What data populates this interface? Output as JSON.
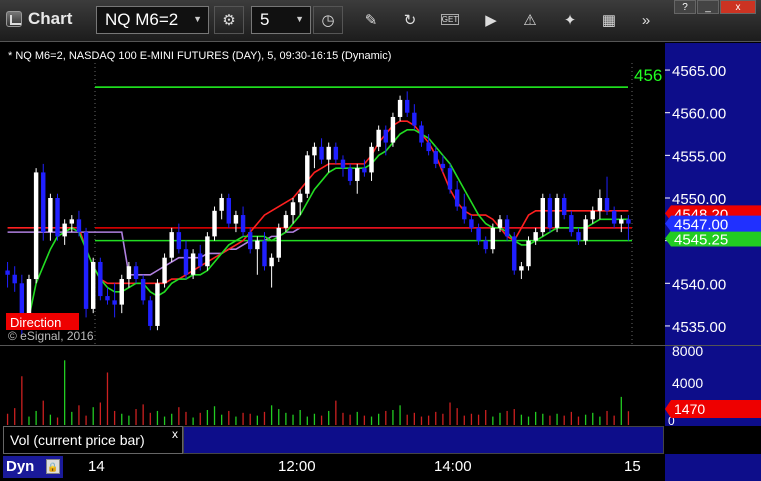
{
  "titlebar": {
    "app_title": "Chart",
    "symbol": "NQ M6=2",
    "interval": "5",
    "window_buttons": [
      "?",
      "_",
      "x"
    ]
  },
  "toolbar": {
    "tools": [
      "link-icon",
      "interval-icon",
      "clock-icon",
      "pencil-icon",
      "refresh-icon",
      "get-icon",
      "play-icon",
      "alert-icon",
      "settings-icon",
      "chevron-icon"
    ]
  },
  "chart": {
    "header": "* NQ M6=2, NASDAQ 100 E-MINI FUTURES (DAY), 5, 09:30-16:15 (Dynamic)",
    "alert_line_label": "456",
    "direction_label": "Direction",
    "watermark": "© eSignal, 2016",
    "price_ticks": [
      "4565.00",
      "4560.00",
      "4555.00",
      "4550.00",
      "4545.00",
      "4540.00",
      "4535.00"
    ],
    "price_flag_high": "4548.20",
    "price_flag_last": "4547.00",
    "price_flag_low": "4545.25",
    "colors": {
      "up_candle": "#ffffff",
      "down_candle": "#2020ff",
      "ma_fast": "#22dd22",
      "ma_slow": "#ff2020",
      "ma_long": "#b080e0",
      "axis_bg": "#0d0d8a"
    }
  },
  "volume": {
    "ticks": [
      "8000",
      "4000",
      "0"
    ],
    "last_volume": "1470",
    "tab_label": "Vol (current price bar)",
    "tab_close": "x"
  },
  "bottom": {
    "mode": "Dyn",
    "time_labels": [
      "14",
      "12:00",
      "14:00",
      "15"
    ]
  },
  "chart_data": {
    "type": "candlestick",
    "ylim": [
      4533,
      4567
    ],
    "candles": [
      [
        4541.5,
        4542.5,
        4539.5,
        4541.0
      ],
      [
        4541.0,
        4542.0,
        4539.0,
        4540.0
      ],
      [
        4540.0,
        4541.0,
        4534.0,
        4535.5
      ],
      [
        4535.5,
        4541.0,
        4535.0,
        4540.5
      ],
      [
        4540.5,
        4553.5,
        4540.0,
        4553.0
      ],
      [
        4553.0,
        4554.0,
        4545.0,
        4546.0
      ],
      [
        4546.0,
        4550.5,
        4545.0,
        4550.0
      ],
      [
        4550.0,
        4550.5,
        4545.0,
        4545.5
      ],
      [
        4545.5,
        4547.5,
        4544.5,
        4547.0
      ],
      [
        4547.0,
        4548.0,
        4546.0,
        4547.5
      ],
      [
        4547.5,
        4548.5,
        4545.5,
        4546.0
      ],
      [
        4546.0,
        4546.5,
        4536.0,
        4537.0
      ],
      [
        4537.0,
        4543.0,
        4536.5,
        4542.5
      ],
      [
        4542.5,
        4543.0,
        4538.0,
        4538.5
      ],
      [
        4538.5,
        4539.5,
        4537.5,
        4538.0
      ],
      [
        4538.0,
        4540.0,
        4536.0,
        4537.5
      ],
      [
        4537.5,
        4541.0,
        4536.5,
        4540.5
      ],
      [
        4540.5,
        4542.5,
        4539.5,
        4542.0
      ],
      [
        4542.0,
        4542.5,
        4540.0,
        4540.5
      ],
      [
        4540.5,
        4541.0,
        4537.5,
        4538.0
      ],
      [
        4538.0,
        4538.5,
        4534.5,
        4535.0
      ],
      [
        4535.0,
        4540.5,
        4534.5,
        4540.0
      ],
      [
        4540.0,
        4543.5,
        4539.5,
        4543.0
      ],
      [
        4543.0,
        4546.5,
        4542.5,
        4546.0
      ],
      [
        4546.0,
        4547.0,
        4543.5,
        4544.0
      ],
      [
        4544.0,
        4545.0,
        4540.5,
        4541.0
      ],
      [
        4541.0,
        4544.0,
        4540.5,
        4543.5
      ],
      [
        4543.5,
        4544.5,
        4541.5,
        4542.0
      ],
      [
        4542.0,
        4546.0,
        4541.5,
        4545.5
      ],
      [
        4545.5,
        4549.0,
        4545.0,
        4548.5
      ],
      [
        4548.5,
        4550.5,
        4547.5,
        4550.0
      ],
      [
        4550.0,
        4550.5,
        4546.5,
        4547.0
      ],
      [
        4547.0,
        4548.5,
        4546.0,
        4548.0
      ],
      [
        4548.0,
        4549.0,
        4545.5,
        4546.0
      ],
      [
        4546.0,
        4546.5,
        4543.5,
        4544.0
      ],
      [
        4544.0,
        4545.5,
        4541.0,
        4545.0
      ],
      [
        4545.0,
        4546.0,
        4541.5,
        4542.0
      ],
      [
        4542.0,
        4543.5,
        4539.5,
        4543.0
      ],
      [
        4543.0,
        4547.0,
        4542.5,
        4546.5
      ],
      [
        4546.5,
        4548.5,
        4546.0,
        4548.0
      ],
      [
        4548.0,
        4550.0,
        4547.0,
        4549.5
      ],
      [
        4549.5,
        4551.0,
        4548.0,
        4550.5
      ],
      [
        4550.5,
        4555.5,
        4550.0,
        4555.0
      ],
      [
        4555.0,
        4556.5,
        4553.5,
        4556.0
      ],
      [
        4556.0,
        4557.0,
        4554.0,
        4554.5
      ],
      [
        4554.5,
        4556.5,
        4553.0,
        4556.0
      ],
      [
        4556.0,
        4556.5,
        4554.0,
        4554.5
      ],
      [
        4554.5,
        4555.0,
        4552.5,
        4553.5
      ],
      [
        4553.5,
        4554.0,
        4551.5,
        4552.0
      ],
      [
        4552.0,
        4554.0,
        4550.5,
        4553.5
      ],
      [
        4553.5,
        4554.5,
        4552.5,
        4553.0
      ],
      [
        4553.0,
        4556.5,
        4552.0,
        4556.0
      ],
      [
        4556.0,
        4558.5,
        4555.5,
        4558.0
      ],
      [
        4558.0,
        4558.5,
        4555.0,
        4556.5
      ],
      [
        4556.5,
        4560.0,
        4556.0,
        4559.5
      ],
      [
        4559.5,
        4562.0,
        4559.0,
        4561.5
      ],
      [
        4561.5,
        4562.5,
        4559.5,
        4560.0
      ],
      [
        4560.0,
        4561.0,
        4558.0,
        4558.5
      ],
      [
        4558.5,
        4559.0,
        4556.0,
        4556.5
      ],
      [
        4556.5,
        4557.5,
        4555.0,
        4555.5
      ],
      [
        4555.5,
        4556.0,
        4553.5,
        4554.0
      ],
      [
        4554.0,
        4555.0,
        4553.0,
        4553.5
      ],
      [
        4553.5,
        4554.0,
        4550.5,
        4551.0
      ],
      [
        4551.0,
        4552.0,
        4548.5,
        4549.0
      ],
      [
        4549.0,
        4550.5,
        4547.0,
        4547.5
      ],
      [
        4547.5,
        4548.0,
        4546.0,
        4546.5
      ],
      [
        4546.5,
        4547.0,
        4544.5,
        4545.0
      ],
      [
        4545.0,
        4545.5,
        4543.5,
        4544.0
      ],
      [
        4544.0,
        4547.0,
        4543.5,
        4546.5
      ],
      [
        4546.5,
        4548.0,
        4546.0,
        4547.5
      ],
      [
        4547.5,
        4548.0,
        4545.0,
        4545.5
      ],
      [
        4545.5,
        4546.0,
        4541.0,
        4541.5
      ],
      [
        4541.5,
        4542.5,
        4540.5,
        4542.0
      ],
      [
        4542.0,
        4545.5,
        4541.5,
        4545.0
      ],
      [
        4545.0,
        4546.5,
        4544.5,
        4546.0
      ],
      [
        4546.0,
        4550.5,
        4545.5,
        4550.0
      ],
      [
        4550.0,
        4550.5,
        4546.0,
        4546.5
      ],
      [
        4546.5,
        4550.5,
        4546.0,
        4550.0
      ],
      [
        4550.0,
        4550.5,
        4547.5,
        4548.0
      ],
      [
        4548.0,
        4548.5,
        4545.5,
        4546.0
      ],
      [
        4546.0,
        4546.5,
        4544.5,
        4545.0
      ],
      [
        4545.0,
        4548.0,
        4544.5,
        4547.5
      ],
      [
        4547.5,
        4549.0,
        4547.0,
        4548.5
      ],
      [
        4548.5,
        4551.0,
        4547.5,
        4550.0
      ],
      [
        4550.0,
        4552.5,
        4548.0,
        4548.5
      ],
      [
        4548.5,
        4549.0,
        4546.5,
        4547.0
      ],
      [
        4547.0,
        4548.0,
        4546.0,
        4547.5
      ],
      [
        4547.5,
        4548.0,
        4545.0,
        4547.0
      ]
    ],
    "alert_line": 4563.0,
    "ma_fast": [
      4536.0,
      4535.5,
      4535.0,
      4536.0,
      4540.0,
      4542.0,
      4544.0,
      4545.5,
      4546.0,
      4546.5,
      4546.0,
      4544.0,
      4542.0,
      4540.5,
      4539.5,
      4539.0,
      4539.0,
      4539.5,
      4540.0,
      4540.0,
      4539.0,
      4538.5,
      4539.0,
      4540.0,
      4540.5,
      4540.5,
      4541.0,
      4541.0,
      4541.5,
      4542.5,
      4543.5,
      4544.5,
      4545.0,
      4545.5,
      4545.5,
      4545.5,
      4545.5,
      4545.0,
      4545.5,
      4546.0,
      4547.0,
      4548.0,
      4549.5,
      4551.0,
      4552.0,
      4553.0,
      4553.5,
      4553.5,
      4553.5,
      4553.5,
      4553.5,
      4554.0,
      4555.0,
      4555.5,
      4556.5,
      4557.5,
      4558.0,
      4558.0,
      4557.5,
      4557.0,
      4556.0,
      4555.0,
      4554.0,
      4552.5,
      4551.0,
      4549.5,
      4548.0,
      4547.0,
      4546.5,
      4546.5,
      4546.0,
      4545.0,
      4544.5,
      4544.5,
      4545.0,
      4545.5,
      4546.0,
      4546.5,
      4546.5,
      4546.5,
      4546.5,
      4546.5,
      4547.0,
      4547.5,
      4547.5,
      4547.5,
      4547.5,
      4547.5
    ],
    "ma_slow": [
      4546.5,
      4546.5,
      4546.5,
      4546.5,
      4546.5,
      4546.5,
      4546.5,
      4546.5,
      4546.5,
      4546.5,
      4546.5,
      4544.0,
      4542.0,
      4540.5,
      4540.0,
      4540.0,
      4540.0,
      4540.0,
      4540.0,
      4540.0,
      4540.0,
      4540.0,
      4540.0,
      4540.5,
      4540.5,
      4541.0,
      4541.5,
      4542.0,
      4542.5,
      4543.0,
      4543.5,
      4544.0,
      4544.5,
      4545.0,
      4546.0,
      4547.0,
      4548.0,
      4548.5,
      4549.0,
      4549.5,
      4550.0,
      4551.0,
      4552.0,
      4553.0,
      4553.5,
      4554.0,
      4554.0,
      4554.0,
      4554.0,
      4554.0,
      4554.0,
      4555.0,
      4556.5,
      4557.5,
      4558.5,
      4559.0,
      4559.0,
      4558.5,
      4557.5,
      4556.5,
      4555.0,
      4553.0,
      4551.0,
      4549.5,
      4548.5,
      4548.0,
      4548.0,
      4548.0,
      4547.5,
      4546.5,
      4545.5,
      4545.0,
      4546.5,
      4548.0,
      4548.5,
      4548.5,
      4548.5,
      4548.5,
      4548.5,
      4548.5,
      4548.5,
      4548.5,
      4548.5,
      4548.5,
      4548.5,
      4548.5,
      4548.5,
      4548.5
    ],
    "ma_long": [
      4546.0,
      4546.0,
      4546.0,
      4546.0,
      4546.0,
      4546.0,
      4546.0,
      4546.0,
      4546.0,
      4546.0,
      4546.0,
      4546.0,
      4546.0,
      4546.0,
      4546.0,
      4546.0,
      4546.0,
      4541.0,
      4541.0,
      4541.0,
      4541.0,
      4541.5,
      4542.0,
      4542.5,
      4543.0,
      4543.0,
      4543.0,
      4543.0,
      4543.5,
      4543.5,
      4543.5,
      4544.0,
      4544.0,
      4544.5,
      4545.0,
      4545.0,
      4545.0,
      4545.5,
      4545.5,
      4546.0,
      4546.0,
      4546.5,
      4546.5,
      4546.5,
      4546.5,
      4546.5,
      4546.5,
      4546.5,
      4546.5,
      4546.5,
      4546.5,
      4546.5,
      4546.5,
      4546.5,
      4546.5,
      4546.5,
      4546.5,
      4546.5,
      4546.5,
      4546.5,
      4546.5,
      4546.5,
      4546.5,
      4546.5,
      4546.5,
      4546.5,
      4546.5,
      4546.5,
      4546.5,
      4546.5,
      4546.5,
      4546.5,
      4546.5,
      4546.5,
      4546.5,
      4546.5,
      4546.5,
      4546.5,
      4546.5,
      4546.5,
      4546.5,
      4546.5,
      4546.5,
      4546.5,
      4546.5,
      4546.5,
      4546.5,
      4546.5
    ],
    "volume_max": 8000,
    "volumes": [
      1200,
      1800,
      5200,
      900,
      1500,
      2600,
      1100,
      800,
      6900,
      1400,
      2100,
      1000,
      1900,
      2400,
      5600,
      1500,
      1200,
      1000,
      1700,
      2200,
      1300,
      1500,
      900,
      1200,
      1900,
      1400,
      800,
      1300,
      1600,
      2000,
      1100,
      1500,
      900,
      1300,
      1200,
      1000,
      1400,
      2100,
      1700,
      1300,
      1100,
      1600,
      900,
      1200,
      1000,
      1500,
      2600,
      1300,
      1100,
      1400,
      1000,
      900,
      1200,
      1500,
      1600,
      2100,
      1100,
      1300,
      900,
      1000,
      1400,
      1200,
      2400,
      1800,
      1000,
      1200,
      1100,
      1600,
      900,
      1300,
      1500,
      1700,
      1100,
      900,
      1400,
      1200,
      1000,
      1200,
      1000,
      1400,
      900,
      1100,
      1300,
      900,
      1500,
      1000,
      3000,
      1470
    ],
    "x_ticks": [
      "14",
      "12:00",
      "14:00",
      "15"
    ]
  }
}
